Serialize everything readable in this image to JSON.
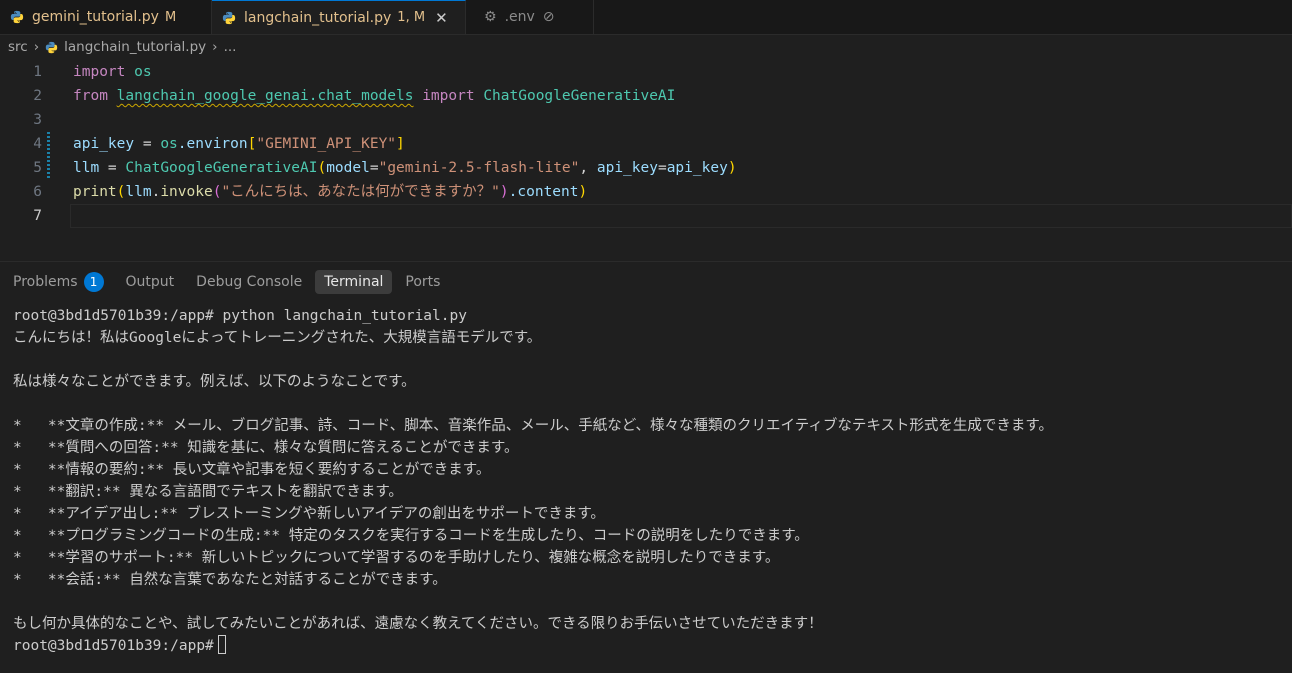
{
  "tabs": [
    {
      "label": "gemini_tutorial.py",
      "badge": "M",
      "icon": "python-icon"
    },
    {
      "label": "langchain_tutorial.py",
      "badge": "1, M",
      "icon": "python-icon",
      "active": true
    },
    {
      "label": ".env",
      "icon": "gear-icon"
    }
  ],
  "breadcrumb": {
    "folder": "src",
    "file": "langchain_tutorial.py",
    "more": "..."
  },
  "editor": {
    "line_numbers": [
      "1",
      "2",
      "3",
      "4",
      "5",
      "6",
      "7"
    ],
    "line1": {
      "import": "import",
      "module": "os"
    },
    "line2": {
      "from": "from",
      "package": "langchain_google_genai.chat_models",
      "import": "import",
      "class": "ChatGoogleGenerativeAI"
    },
    "line4": {
      "var": "api_key",
      "eq": " = ",
      "obj": "os",
      "attr": ".environ",
      "open": "[",
      "key": "\"GEMINI_API_KEY\"",
      "close": "]"
    },
    "line5": {
      "var": "llm",
      "eq": " = ",
      "cls": "ChatGoogleGenerativeAI",
      "open": "(",
      "param1": "model",
      "eq1": "=",
      "val1": "\"gemini-2.5-flash-lite\"",
      "comma": ", ",
      "param2": "api_key",
      "eq2": "=",
      "val2": "api_key",
      "close": ")"
    },
    "line6": {
      "fn": "print",
      "open": "(",
      "obj": "llm",
      "dot": ".",
      "method": "invoke",
      "open2": "(",
      "arg": "\"こんにちは、あなたは何ができますか？\"",
      "close2": ")",
      "attr": ".content",
      "close": ")"
    }
  },
  "panel": {
    "tabs": [
      "Problems",
      "Output",
      "Debug Console",
      "Terminal",
      "Ports"
    ],
    "problems_count": "1",
    "active_tab": "Terminal"
  },
  "terminal": {
    "lines": [
      "root@3bd1d5701b39:/app# python langchain_tutorial.py",
      "こんにちは！私はGoogleによってトレーニングされた、大規模言語モデルです。",
      "",
      "私は様々なことができます。例えば、以下のようなことです。",
      "",
      "*   **文章の作成:** メール、ブログ記事、詩、コード、脚本、音楽作品、メール、手紙など、様々な種類のクリエイティブなテキスト形式を生成できます。",
      "*   **質問への回答:** 知識を基に、様々な質問に答えることができます。",
      "*   **情報の要約:** 長い文章や記事を短く要約することができます。",
      "*   **翻訳:** 異なる言語間でテキストを翻訳できます。",
      "*   **アイデア出し:** ブレストーミングや新しいアイデアの創出をサポートできます。",
      "*   **プログラミングコードの生成:** 特定のタスクを実行するコードを生成したり、コードの説明をしたりできます。",
      "*   **学習のサポート:** 新しいトピックについて学習するのを手助けしたり、複雑な概念を説明したりできます。",
      "*   **会話:** 自然な言葉であなたと対話することができます。",
      "",
      "もし何か具体的なことや、試してみたいことがあれば、遠慮なく教えてください。できる限りお手伝いさせていただきます！"
    ],
    "prompt": "root@3bd1d5701b39:/app#"
  }
}
